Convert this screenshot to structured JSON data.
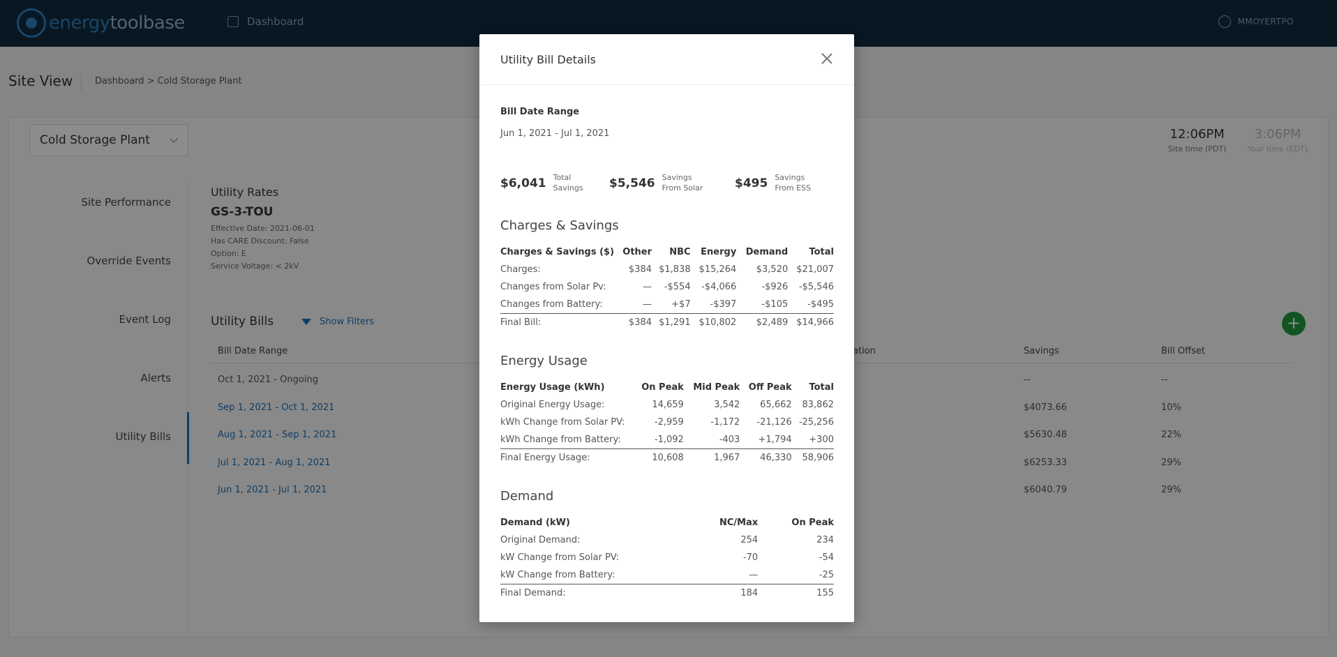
{
  "app": {
    "logo_part1": "energy",
    "logo_part2": "toolbase",
    "nav_dashboard": "Dashboard",
    "user": "MMOYERTPO"
  },
  "page": {
    "title": "Site View",
    "breadcrumb": "Dashboard > Cold Storage Plant",
    "site_select": "Cold Storage Plant",
    "site_time": "12:06PM",
    "site_time_label": "Site time (PDT)",
    "your_time": "3:06PM",
    "your_time_label": "Your time (EDT)"
  },
  "sidebar": {
    "items": [
      "Site Performance",
      "Override Events",
      "Event Log",
      "Alerts",
      "Utility Bills"
    ],
    "active": "Utility Bills"
  },
  "rates": {
    "title": "Utility Rates",
    "code": "GS-3-TOU",
    "lines": [
      "Effective Date: 2021-06-01",
      "Has CARE Discount: False",
      "Option: E",
      "Service Voltage: < 2kV"
    ]
  },
  "bills": {
    "title": "Utility Bills",
    "show_filters": "Show Filters",
    "columns": [
      "Bill Date Range",
      "ation",
      "Savings",
      "Bill Offset"
    ],
    "rows": [
      {
        "range": "Oct 1, 2021 - Ongoing",
        "savings": "--",
        "offset": "--"
      },
      {
        "range": "Sep 1, 2021 - Oct 1, 2021",
        "savings": "$4073.66",
        "offset": "10%"
      },
      {
        "range": "Aug 1, 2021 - Sep 1, 2021",
        "savings": "$5630.48",
        "offset": "22%"
      },
      {
        "range": "Jul 1, 2021 - Aug 1, 2021",
        "savings": "$6253.33",
        "offset": "29%"
      },
      {
        "range": "Jun 1, 2021 - Jul 1, 2021",
        "savings": "$6040.79",
        "offset": "29%"
      }
    ]
  },
  "modal": {
    "title": "Utility Bill Details",
    "bill_date_range_label": "Bill Date Range",
    "bill_date_range": "Jun 1, 2021 - Jul 1, 2021",
    "savings": [
      {
        "amount": "$6,041",
        "cap1": "Total",
        "cap2": "Savings"
      },
      {
        "amount": "$5,546",
        "cap1": "Savings",
        "cap2": "From Solar"
      },
      {
        "amount": "$495",
        "cap1": "Savings",
        "cap2": "From ESS"
      }
    ],
    "charges": {
      "title": "Charges & Savings",
      "header": [
        "Charges & Savings ($)",
        "Other",
        "NBC",
        "Energy",
        "Demand",
        "Total"
      ],
      "rows": [
        [
          "Charges:",
          "$384",
          "$1,838",
          "$15,264",
          "$3,520",
          "$21,007"
        ],
        [
          "Changes from Solar Pv:",
          "—",
          "-$554",
          "-$4,066",
          "-$926",
          "-$5,546"
        ],
        [
          "Changes from Battery:",
          "—",
          "+$7",
          "-$397",
          "-$105",
          "-$495"
        ]
      ],
      "final": [
        "Final Bill:",
        "$384",
        "$1,291",
        "$10,802",
        "$2,489",
        "$14,966"
      ]
    },
    "energy": {
      "title": "Energy Usage",
      "header": [
        "Energy Usage (kWh)",
        "On Peak",
        "Mid Peak",
        "Off Peak",
        "Total"
      ],
      "rows": [
        [
          "Original Energy Usage:",
          "14,659",
          "3,542",
          "65,662",
          "83,862"
        ],
        [
          "kWh Change from Solar PV:",
          "-2,959",
          "-1,172",
          "-21,126",
          "-25,256"
        ],
        [
          "kWh Change from Battery:",
          "-1,092",
          "-403",
          "+1,794",
          "+300"
        ]
      ],
      "final": [
        "Final Energy Usage:",
        "10,608",
        "1,967",
        "46,330",
        "58,906"
      ]
    },
    "demand": {
      "title": "Demand",
      "header": [
        "Demand (kW)",
        "NC/Max",
        "On Peak"
      ],
      "rows": [
        [
          "Original Demand:",
          "254",
          "234"
        ],
        [
          "kW Change from Solar PV:",
          "-70",
          "-54"
        ],
        [
          "kW Change from Battery:",
          "—",
          "-25"
        ]
      ],
      "final": [
        "Final Demand:",
        "184",
        "155"
      ]
    }
  }
}
